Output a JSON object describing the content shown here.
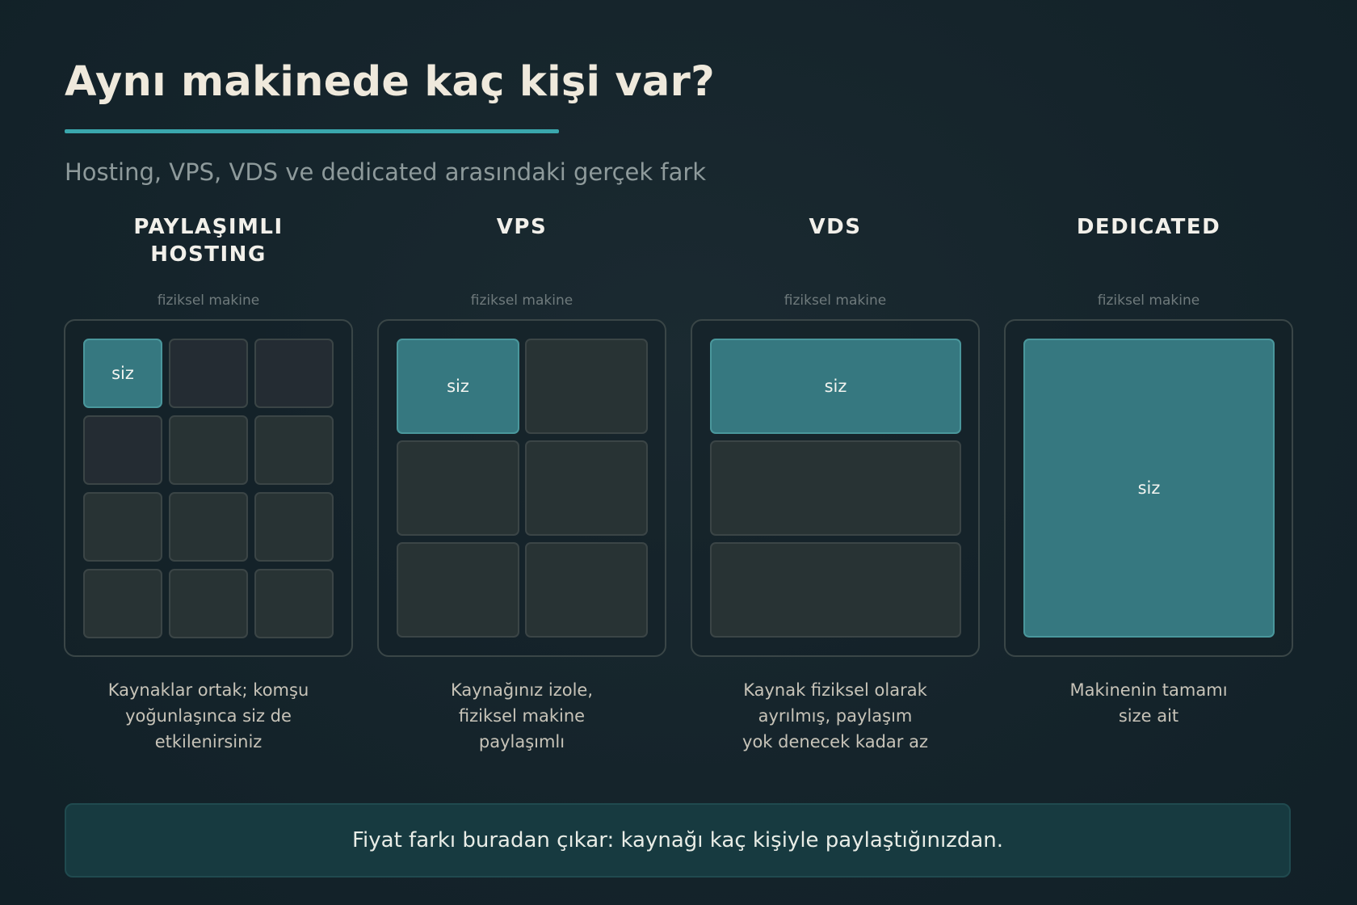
{
  "title": "Aynı makinede kaç kişi var?",
  "subtitle": "Hosting, VPS, VDS ve dedicated arasındaki gerçek fark",
  "machine_label": "fiziksel makine",
  "you_label": "siz",
  "accent_color": "#3aa7ad",
  "columns": [
    {
      "title_lines": [
        "PAYLAŞIMLI",
        "HOSTING"
      ],
      "slot_count": 12,
      "desc_lines": [
        "Kaynaklar ortak; komşu",
        "yoğunlaşınca siz de",
        "etkilenirsiniz"
      ]
    },
    {
      "title_lines": [
        "VPS"
      ],
      "slot_count": 6,
      "desc_lines": [
        "Kaynağınız izole,",
        "fiziksel makine",
        "paylaşımlı"
      ]
    },
    {
      "title_lines": [
        "VDS"
      ],
      "slot_count": 3,
      "desc_lines": [
        "Kaynak fiziksel olarak",
        "ayrılmış, paylaşım",
        "yok denecek kadar az"
      ]
    },
    {
      "title_lines": [
        "DEDICATED"
      ],
      "slot_count": 1,
      "desc_lines": [
        "Makinenin tamamı",
        "size ait"
      ]
    }
  ],
  "footer": "Fiyat farkı buradan çıkar: kaynağı kaç kişiyle paylaştığınızdan."
}
